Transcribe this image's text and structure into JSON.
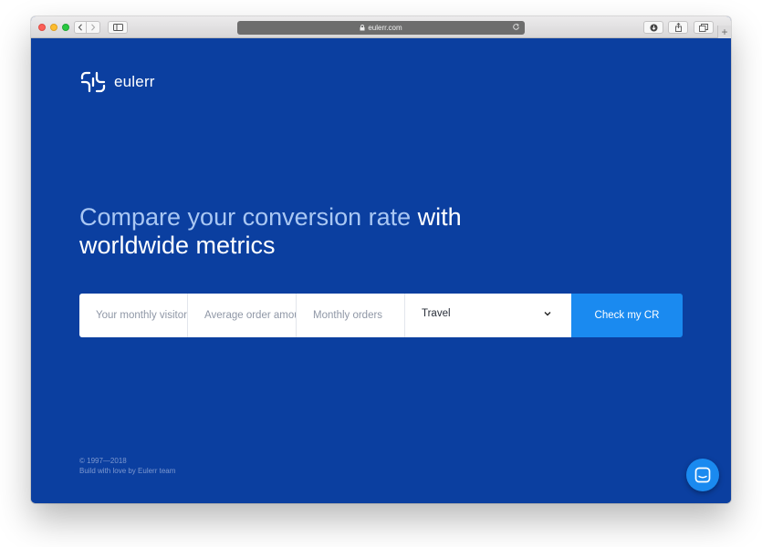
{
  "browser": {
    "url": "eulerr.com",
    "new_tab_label": "+"
  },
  "brand": {
    "name": "eulerr"
  },
  "hero": {
    "headline_light": "Compare your conversion rate",
    "headline_bold": " with worldwide metrics"
  },
  "form": {
    "visitors_placeholder": "Your monthly visitors",
    "order_placeholder": "Average order amount",
    "orders_placeholder": "Monthly orders",
    "industry_selected": "Travel",
    "submit_label": "Check my CR"
  },
  "footer": {
    "copyright": "© 1997—2018",
    "credit": "Build with love by Eulerr team"
  },
  "colors": {
    "page_background": "#0b3fa0",
    "accent": "#1a8af0",
    "headline_light": "#a9c7f3"
  },
  "icons": {
    "chat": "chat-bubble-icon",
    "logo": "eulerr-logo-icon"
  }
}
